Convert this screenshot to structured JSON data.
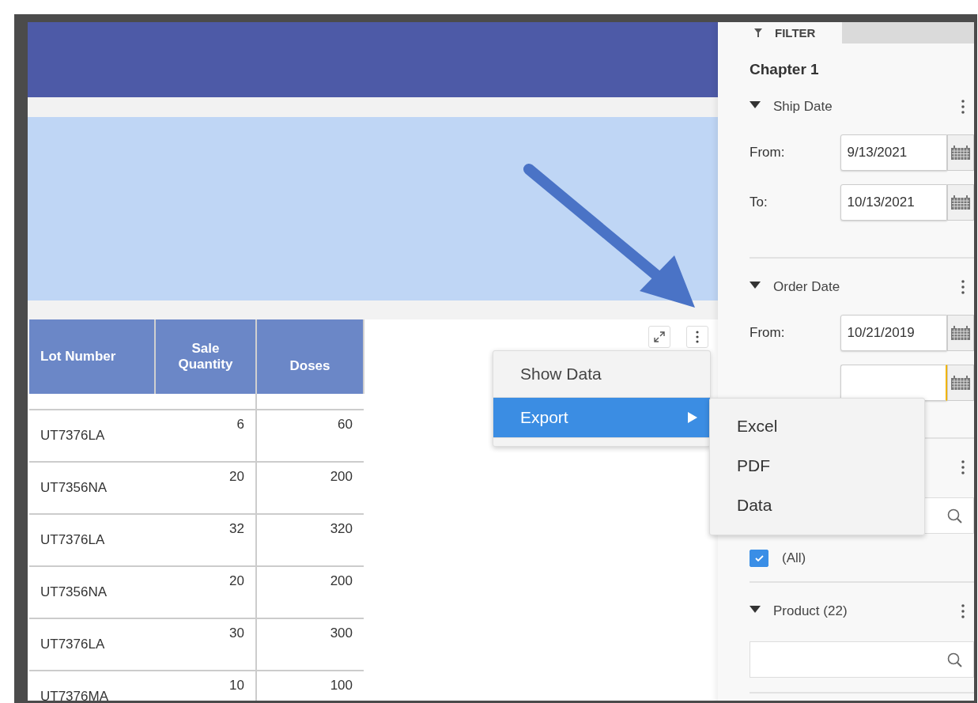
{
  "table": {
    "columns": [
      "Lot Number",
      "Sale Quantity",
      "Doses"
    ],
    "rows": [
      [
        "UT7376LA",
        "6",
        "60"
      ],
      [
        "UT7356NA",
        "20",
        "200"
      ],
      [
        "UT7376LA",
        "32",
        "320"
      ],
      [
        "UT7356NA",
        "20",
        "200"
      ],
      [
        "UT7376LA",
        "30",
        "300"
      ],
      [
        "UT7376MA",
        "10",
        "100"
      ]
    ]
  },
  "context_menu": {
    "items": [
      {
        "label": "Show Data",
        "selected": false,
        "submenu": false
      },
      {
        "label": "Export",
        "selected": true,
        "submenu": true
      }
    ],
    "submenu": [
      "Excel",
      "PDF",
      "Data"
    ]
  },
  "filter_panel": {
    "tab": "FILTER",
    "title": "Chapter 1",
    "sections": [
      {
        "kind": "date_range",
        "title": "Ship Date",
        "expanded": true,
        "fields": [
          {
            "label": "From:",
            "value": "9/13/2021",
            "focused": false
          },
          {
            "label": "To:",
            "value": "10/13/2021",
            "focused": false
          }
        ]
      },
      {
        "kind": "date_range",
        "title": "Order Date",
        "expanded": true,
        "fields": [
          {
            "label": "From:",
            "value": "10/21/2019",
            "focused": false
          },
          {
            "focused": true
          }
        ]
      },
      {
        "kind": "list",
        "items": [
          {
            "label": "(All)",
            "checked": true
          }
        ]
      },
      {
        "kind": "list",
        "title": "Product (22)",
        "expanded": true
      }
    ]
  }
}
